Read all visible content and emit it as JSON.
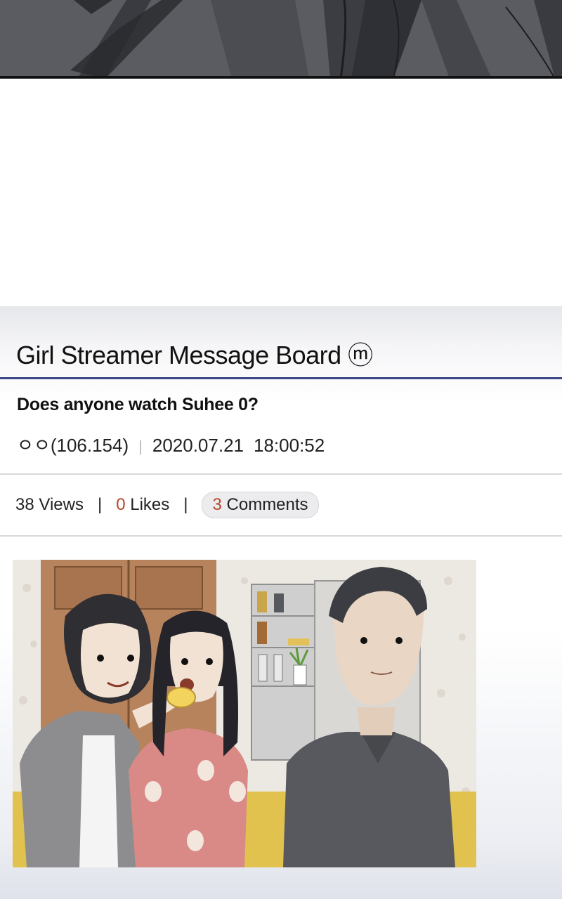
{
  "board": {
    "title": "Girl Streamer Message Board ⓜ",
    "post": {
      "title": "Does anyone watch Suhee 0?",
      "author": "ㅇㅇ(106.154)",
      "separator": "|",
      "date": "2020.07.21",
      "time": "18:00:52"
    },
    "stats": {
      "views_label": "38 Views",
      "likes_count": "0",
      "likes_word": "Likes",
      "comments_count": "3",
      "comments_word": "Comments",
      "divider": "|"
    }
  },
  "colors": {
    "accent_rule": "#3d4a85",
    "count_red": "#b5462a",
    "top_panel": "#5b5c61"
  }
}
